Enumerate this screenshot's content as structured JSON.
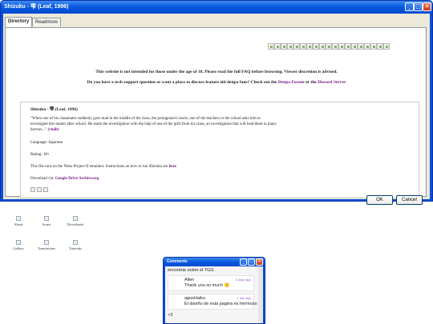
{
  "window": {
    "title": "Shizuku - 雫 (Leaf, 1996)",
    "buttons": [
      "_",
      "□",
      "✕"
    ]
  },
  "tabs": [
    "Directory",
    "Readmore"
  ],
  "notices": {
    "age": "This website is not intended for those under the age of 18. Please read the full FAQ before browsing. Viewer discretion is advised.",
    "support_prefix": "Do you have a tech support question or want a place to discuss feature old denpa fans? Check out the",
    "support_link1": "Denpa Forum",
    "support_mid": "or the",
    "support_link2": "Discord Server"
  },
  "entry": {
    "title": "Shizuku - 雫 (Leaf, 1996)",
    "description_line1": "\"When one of his classmates suddenly goes mad in the middle of the class, the protagonist's uncle, one of the teachers in the school asks him to",
    "description_line2": "investigate this matter after school. He starts the investigation with the help of one of the girls from his class, an investigation that will lead them to many",
    "description_line3": "horrors...\"",
    "vndb": "(vndb)",
    "language": "Language: Japanese",
    "rating": "Rating: 18+",
    "emulator_prefix": "This file runs on the Neko Project II emulator. Instructions on how to run Shizuku are",
    "emulator_link": "here",
    "download_prefix": "Download via:",
    "download_link": "Google Drive Archive.org"
  },
  "dialog_buttons": {
    "ok": "OK",
    "cancel": "Cancel"
  },
  "desktop_icons": [
    "About",
    "Scans",
    "Downloads",
    "Gallery",
    "Translations",
    "Tutorials"
  ],
  "comments": {
    "title": "Comments",
    "top_partial": "encontrar sobre el TGG",
    "messages": [
      {
        "user": "Allen",
        "time": "2 days ago",
        "text": "Thank you so much 🙂"
      },
      {
        "user": "agusHaiku",
        "time": "1 day ago",
        "text": "El diseño de esta pagina es hermoso"
      }
    ],
    "tail": "<3"
  }
}
